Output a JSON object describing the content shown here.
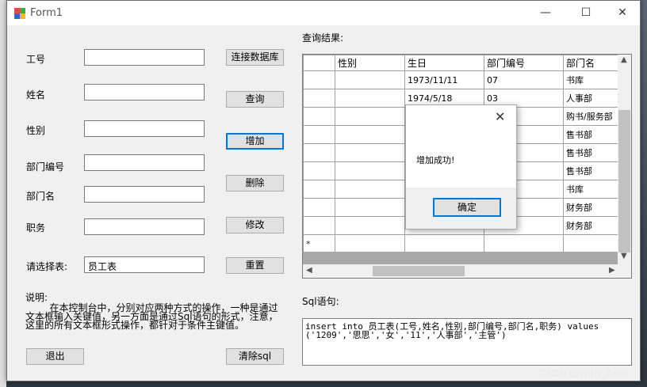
{
  "window": {
    "title": "Form1",
    "minimize": "—",
    "maximize": "☐",
    "close": "✕"
  },
  "form": {
    "fields": [
      {
        "label": "工号",
        "value": ""
      },
      {
        "label": "姓名",
        "value": ""
      },
      {
        "label": "性别",
        "value": ""
      },
      {
        "label": "部门编号",
        "value": ""
      },
      {
        "label": "部门名",
        "value": ""
      },
      {
        "label": "职务",
        "value": ""
      }
    ],
    "table_select_label": "请选择表:",
    "table_select_value": "员工表",
    "buttons": {
      "connect": "连接数据库",
      "query": "查询",
      "add": "增加",
      "delete": "删除",
      "modify": "修改",
      "reset": "重置",
      "exit": "退出",
      "clear_sql": "清除sql"
    },
    "description_title": "说明:",
    "description_text": "        在本控制台中，分别对应两种方式的操作，一种是通过文本框输入关键值，另一方面是通过Sql语句的形式，注意，这里的所有文本框形式操作，都针对于条件主键值。"
  },
  "results": {
    "title": "查询结果:",
    "columns": [
      "性别",
      "生日",
      "部门编号",
      "部门名"
    ],
    "rows": [
      [
        "",
        "1973/11/11",
        "07",
        "书库"
      ],
      [
        "",
        "1974/5/18",
        "03",
        "人事部"
      ],
      [
        "",
        "",
        "",
        "购书/服务部"
      ],
      [
        "",
        "",
        "",
        "售书部"
      ],
      [
        "",
        "",
        "",
        "售书部"
      ],
      [
        "",
        "",
        "",
        "售书部"
      ],
      [
        "",
        "",
        "",
        "书库"
      ],
      [
        "",
        "",
        "",
        "财务部"
      ],
      [
        "",
        "",
        "",
        "财务部"
      ]
    ],
    "new_row_marker": "*"
  },
  "sql": {
    "label": "Sql语句:",
    "text": "insert into 员工表(工号,姓名,性别,部门编号,部门名,职务) values\n('1209','思思','女','11','人事部','主管')"
  },
  "dialog": {
    "message": "增加成功!",
    "ok": "确定",
    "close": "✕"
  },
  "watermark": "CSDN @With_Zero"
}
